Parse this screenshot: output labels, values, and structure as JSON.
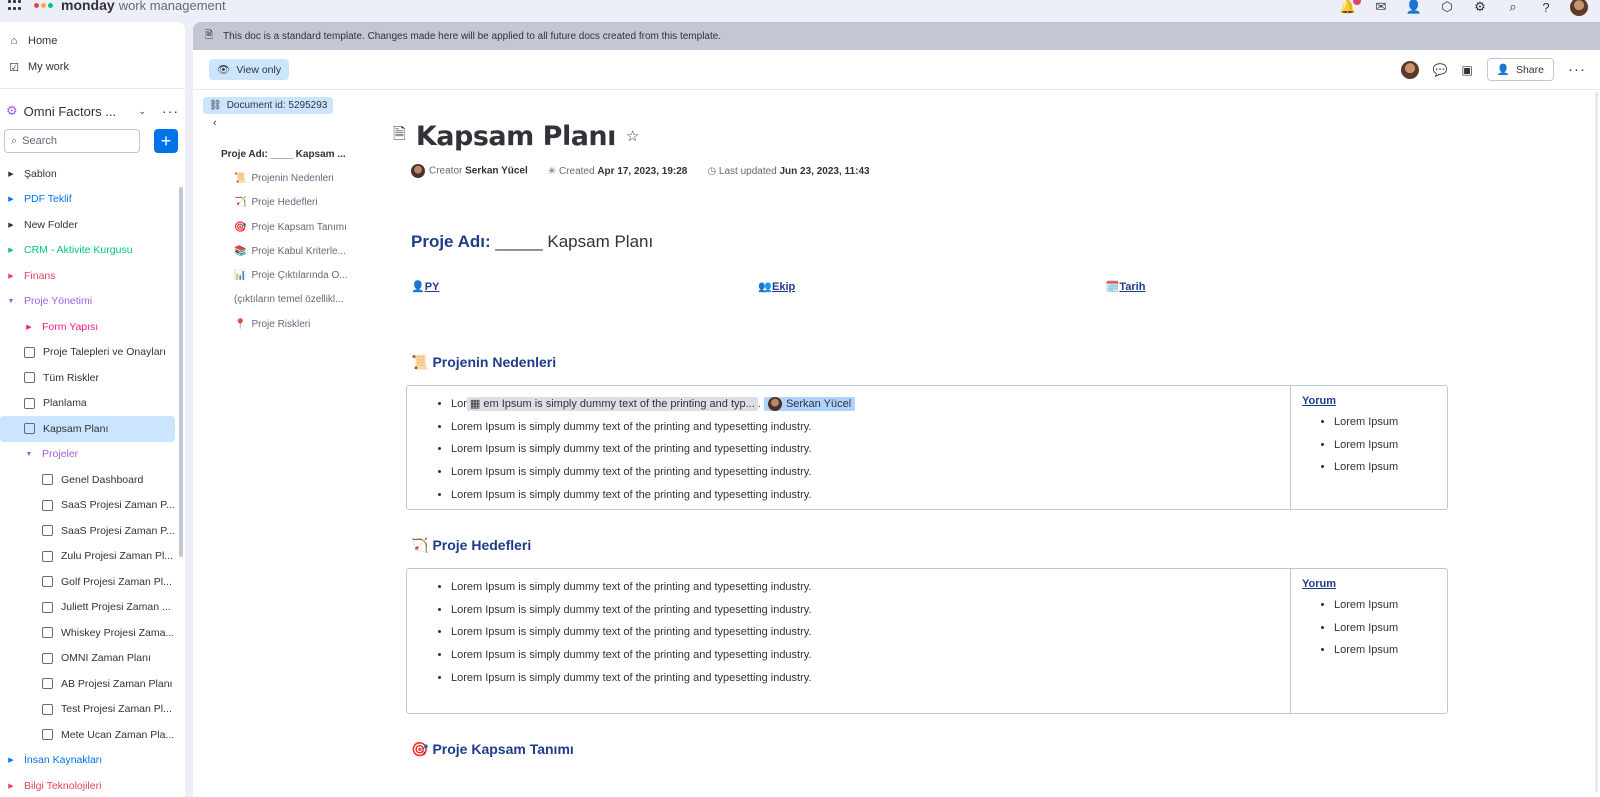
{
  "app": {
    "brand": "monday",
    "product": "work management"
  },
  "top_icons": [
    "bell-icon",
    "inbox-icon",
    "invite-icon",
    "apps-icon",
    "integrations-icon",
    "search-icon",
    "help-icon"
  ],
  "nav": {
    "home": "Home",
    "my_work": "My work"
  },
  "workspace": {
    "name": "Omni Factors ..."
  },
  "search": {
    "placeholder": "Search"
  },
  "tree": [
    {
      "label": "Şablon",
      "color": "#323338",
      "type": "folder",
      "indent": 0
    },
    {
      "label": "PDF Teklif",
      "color": "#0073ea",
      "type": "folder",
      "indent": 0
    },
    {
      "label": "New Folder",
      "color": "#323338",
      "type": "folder",
      "indent": 0
    },
    {
      "label": "CRM - Aktivite Kurgusu",
      "color": "#00c875",
      "type": "folder",
      "indent": 0
    },
    {
      "label": "Finans",
      "color": "#e2445c",
      "type": "folder",
      "indent": 0
    },
    {
      "label": "Proje Yönetimi",
      "color": "#a25ddc",
      "type": "folder-open",
      "indent": 0
    },
    {
      "label": "Form Yapısı",
      "color": "#ff158a",
      "type": "folder",
      "indent": 1
    },
    {
      "label": "Proje Talepleri ve Onayları",
      "color": "#323338",
      "type": "doc",
      "indent": 1
    },
    {
      "label": "Tüm Riskler",
      "color": "#323338",
      "type": "board",
      "indent": 1
    },
    {
      "label": "Planlama",
      "color": "#323338",
      "type": "doc",
      "indent": 1
    },
    {
      "label": "Kapsam Planı",
      "color": "#323338",
      "type": "doc",
      "indent": 1,
      "active": true
    },
    {
      "label": "Projeler",
      "color": "#a25ddc",
      "type": "folder-open",
      "indent": 1
    },
    {
      "label": "Genel Dashboard",
      "color": "#323338",
      "type": "dashboard",
      "indent": 2
    },
    {
      "label": "SaaS Projesi Zaman P...",
      "color": "#323338",
      "type": "board",
      "indent": 2
    },
    {
      "label": "SaaS Projesi Zaman P...",
      "color": "#323338",
      "type": "board",
      "indent": 2
    },
    {
      "label": "Zulu Projesi Zaman Pl...",
      "color": "#323338",
      "type": "board",
      "indent": 2
    },
    {
      "label": "Golf Projesi Zaman Pl...",
      "color": "#323338",
      "type": "board",
      "indent": 2
    },
    {
      "label": "Juliett Projesi Zaman ...",
      "color": "#323338",
      "type": "board",
      "indent": 2
    },
    {
      "label": "Whiskey Projesi Zama...",
      "color": "#323338",
      "type": "board",
      "indent": 2
    },
    {
      "label": "OMNI Zaman Planı",
      "color": "#323338",
      "type": "board",
      "indent": 2
    },
    {
      "label": "AB Projesi Zaman Planı",
      "color": "#323338",
      "type": "board",
      "indent": 2
    },
    {
      "label": "Test Projesi Zaman Pl...",
      "color": "#323338",
      "type": "board",
      "indent": 2
    },
    {
      "label": "Mete Ucan Zaman Pla...",
      "color": "#323338",
      "type": "board",
      "indent": 2
    },
    {
      "label": "İnsan Kaynakları",
      "color": "#0073ea",
      "type": "folder",
      "indent": 0
    },
    {
      "label": "Bilgi Teknolojileri",
      "color": "#e2445c",
      "type": "folder",
      "indent": 0
    }
  ],
  "banner": {
    "text": "This doc is a standard template. Changes made here will be applied to all future docs created from this template."
  },
  "toolbar": {
    "view_only": "View only",
    "share": "Share"
  },
  "doc_id": "Document id: 5295293",
  "toc": [
    {
      "label": "Proje Adı: ____ Kapsam ...",
      "level": 0,
      "emoji": ""
    },
    {
      "label": "Projenin Nedenleri",
      "level": 1,
      "emoji": "📜"
    },
    {
      "label": "Proje Hedefleri",
      "level": 1,
      "emoji": "🏹"
    },
    {
      "label": "Proje Kapsam Tanımı",
      "level": 1,
      "emoji": "🎯"
    },
    {
      "label": "Proje Kabul Kriterle...",
      "level": 1,
      "emoji": "📚"
    },
    {
      "label": "Proje Çıktılarında O...",
      "level": 1,
      "emoji": "📊"
    },
    {
      "label": "(çıktıların temel özellikl...",
      "level": 1,
      "emoji": ""
    },
    {
      "label": "Proje Riskleri",
      "level": 1,
      "emoji": "📍"
    }
  ],
  "doc": {
    "title": "Kapsam Planı",
    "creator_label": "Creator",
    "creator": "Serkan Yücel",
    "created_label": "Created",
    "created": "Apr 17, 2023, 19:28",
    "updated_label": "Last updated",
    "updated": "Jun 23, 2023, 11:43",
    "project_heading_bold": "Proje Adı:",
    "project_heading_rest": " _____ Kapsam Planı",
    "roles": [
      {
        "emoji": "👤",
        "label": "PY"
      },
      {
        "emoji": "👥",
        "label": "Ekip"
      },
      {
        "emoji": "🗓️",
        "label": "Tarih"
      }
    ],
    "sections": [
      {
        "emoji": "📜",
        "title": "Projenin Nedenleri",
        "first_item": {
          "prefix": "Lor",
          "highlight": "em Ipsum is simply dummy text of the printing and typ...",
          "sep": ".",
          "mention": "Serkan Yücel"
        },
        "items": [
          "Lorem Ipsum is simply dummy text of the printing and typesetting industry.",
          "Lorem Ipsum is simply dummy text of the printing and typesetting industry.",
          "Lorem Ipsum is simply dummy text of the printing and typesetting industry.",
          "Lorem Ipsum is simply dummy text of the printing and typesetting industry."
        ],
        "comment_title": "Yorum",
        "comments": [
          "Lorem Ipsum",
          "Lorem Ipsum",
          "Lorem Ipsum"
        ]
      },
      {
        "emoji": "🏹",
        "title": "Proje Hedefleri",
        "items": [
          "Lorem Ipsum is simply dummy text of the printing and typesetting industry.",
          "Lorem Ipsum is simply dummy text of the printing and typesetting industry.",
          "Lorem Ipsum is simply dummy text of the printing and typesetting industry.",
          "Lorem Ipsum is simply dummy text of the printing and typesetting industry.",
          "Lorem Ipsum is simply dummy text of the printing and typesetting industry."
        ],
        "comment_title": "Yorum",
        "comments": [
          "Lorem Ipsum",
          "Lorem Ipsum",
          "Lorem Ipsum"
        ]
      },
      {
        "emoji": "🎯",
        "title": "Proje Kapsam Tanımı"
      }
    ]
  }
}
